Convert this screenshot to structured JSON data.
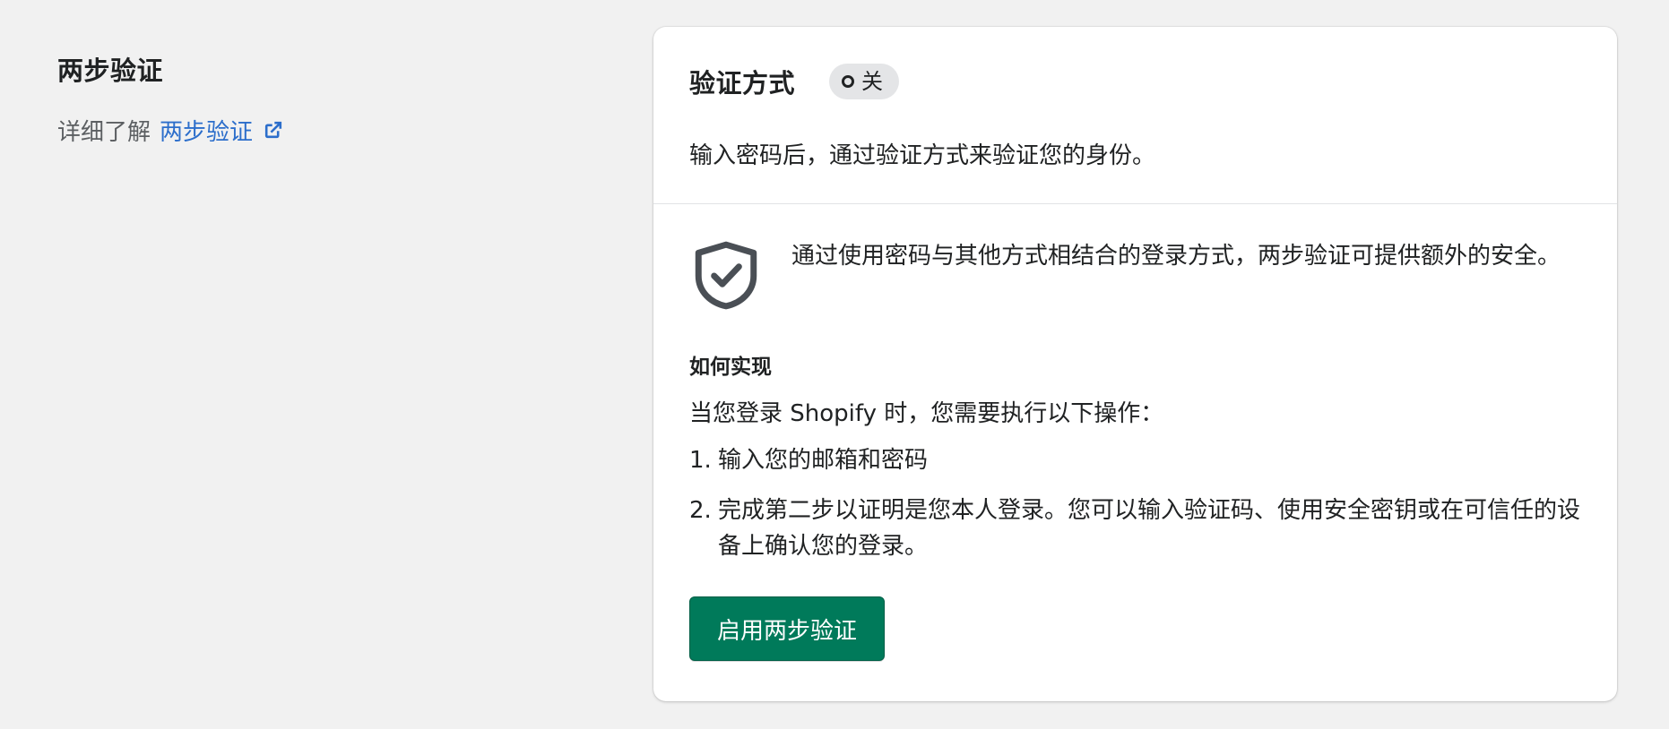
{
  "section": {
    "title": "两步验证",
    "learn_more_prefix": "详细了解",
    "learn_more_link": "两步验证",
    "link_icon": "external-link-icon"
  },
  "card": {
    "title": "验证方式",
    "status_badge": "关",
    "description": "输入密码后，通过验证方式来验证您的身份。",
    "feature_icon": "shield-check-icon",
    "feature_text": "通过使用密码与其他方式相结合的登录方式，两步验证可提供额外的安全。",
    "how_title": "如何实现",
    "how_desc": "当您登录 Shopify 时，您需要执行以下操作：",
    "steps": [
      {
        "num": "1.",
        "text": "输入您的邮箱和密码"
      },
      {
        "num": "2.",
        "text": "完成第二步以证明是您本人登录。您可以输入验证码、使用安全密钥或在可信任的设备上确认您的登录。"
      }
    ],
    "enable_button": "启用两步验证"
  },
  "colors": {
    "page_bg": "#f1f1f1",
    "link": "#2c6ecb",
    "primary": "#007a5a",
    "badge_bg": "#e4e5e7"
  }
}
